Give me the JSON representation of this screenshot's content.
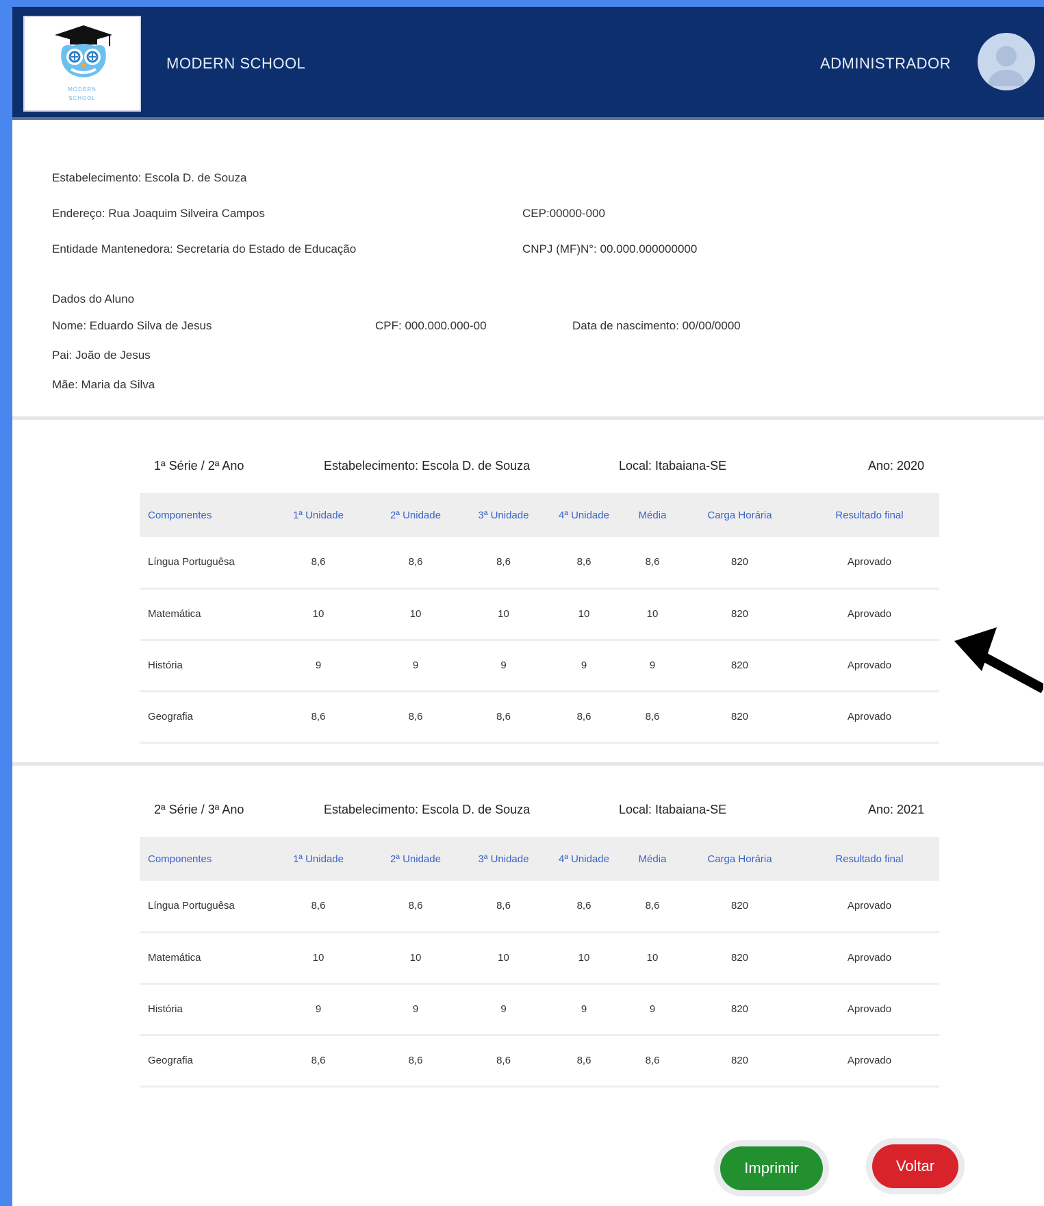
{
  "header": {
    "school_name": "MODERN SCHOOL",
    "user_role": "ADMINISTRADOR",
    "logo_text": [
      "MODERN",
      "SCHOOL"
    ]
  },
  "institution": {
    "establishment": "Estabelecimento: Escola D. de Souza",
    "address": "Endereço: Rua Joaquim Silveira Campos",
    "cep": "CEP:00000-000",
    "entity": "Entidade Mantenedora: Secretaria do Estado de Educação",
    "cnpj": "CNPJ (MF)N°: 00.000.000000000"
  },
  "student": {
    "section_title": "Dados do Aluno",
    "name": "Nome: Eduardo Silva de Jesus",
    "cpf": "CPF: 000.000.000-00",
    "birth": "Data de nascimento: 00/00/0000",
    "father": "Pai: João de Jesus",
    "mother": "Mãe: Maria da Silva"
  },
  "columns": [
    "Componentes",
    "1ª Unidade",
    "2ª Unidade",
    "3ª Unidade",
    "4ª Unidade",
    "Média",
    "Carga Horária",
    "Resultado final"
  ],
  "records": [
    {
      "serie": "1ª Série / 2ª Ano",
      "establishment": "Estabelecimento: Escola D. de Souza",
      "local": "Local: Itabaiana-SE",
      "year": "Ano: 2020",
      "rows": [
        [
          "Língua Portuguêsa",
          "8,6",
          "8,6",
          "8,6",
          "8,6",
          "8,6",
          "820",
          "Aprovado"
        ],
        [
          "Matemática",
          "10",
          "10",
          "10",
          "10",
          "10",
          "820",
          "Aprovado"
        ],
        [
          "História",
          "9",
          "9",
          "9",
          "9",
          "9",
          "820",
          "Aprovado"
        ],
        [
          "Geografia",
          "8,6",
          "8,6",
          "8,6",
          "8,6",
          "8,6",
          "820",
          "Aprovado"
        ]
      ]
    },
    {
      "serie": "2ª Série / 3ª Ano",
      "establishment": "Estabelecimento: Escola D. de Souza",
      "local": "Local: Itabaiana-SE",
      "year": "Ano: 2021",
      "rows": [
        [
          "Língua Portuguêsa",
          "8,6",
          "8,6",
          "8,6",
          "8,6",
          "8,6",
          "820",
          "Aprovado"
        ],
        [
          "Matemática",
          "10",
          "10",
          "10",
          "10",
          "10",
          "820",
          "Aprovado"
        ],
        [
          "História",
          "9",
          "9",
          "9",
          "9",
          "9",
          "820",
          "Aprovado"
        ],
        [
          "Geografia",
          "8,6",
          "8,6",
          "8,6",
          "8,6",
          "8,6",
          "820",
          "Aprovado"
        ]
      ]
    }
  ],
  "buttons": {
    "print": "Imprimir",
    "back": "Voltar"
  },
  "colors": {
    "header_bg": "#0d2f6e",
    "frame": "#4a86f0",
    "print": "#23902f",
    "back": "#d8232a",
    "column_header_text": "#3a63c7"
  }
}
